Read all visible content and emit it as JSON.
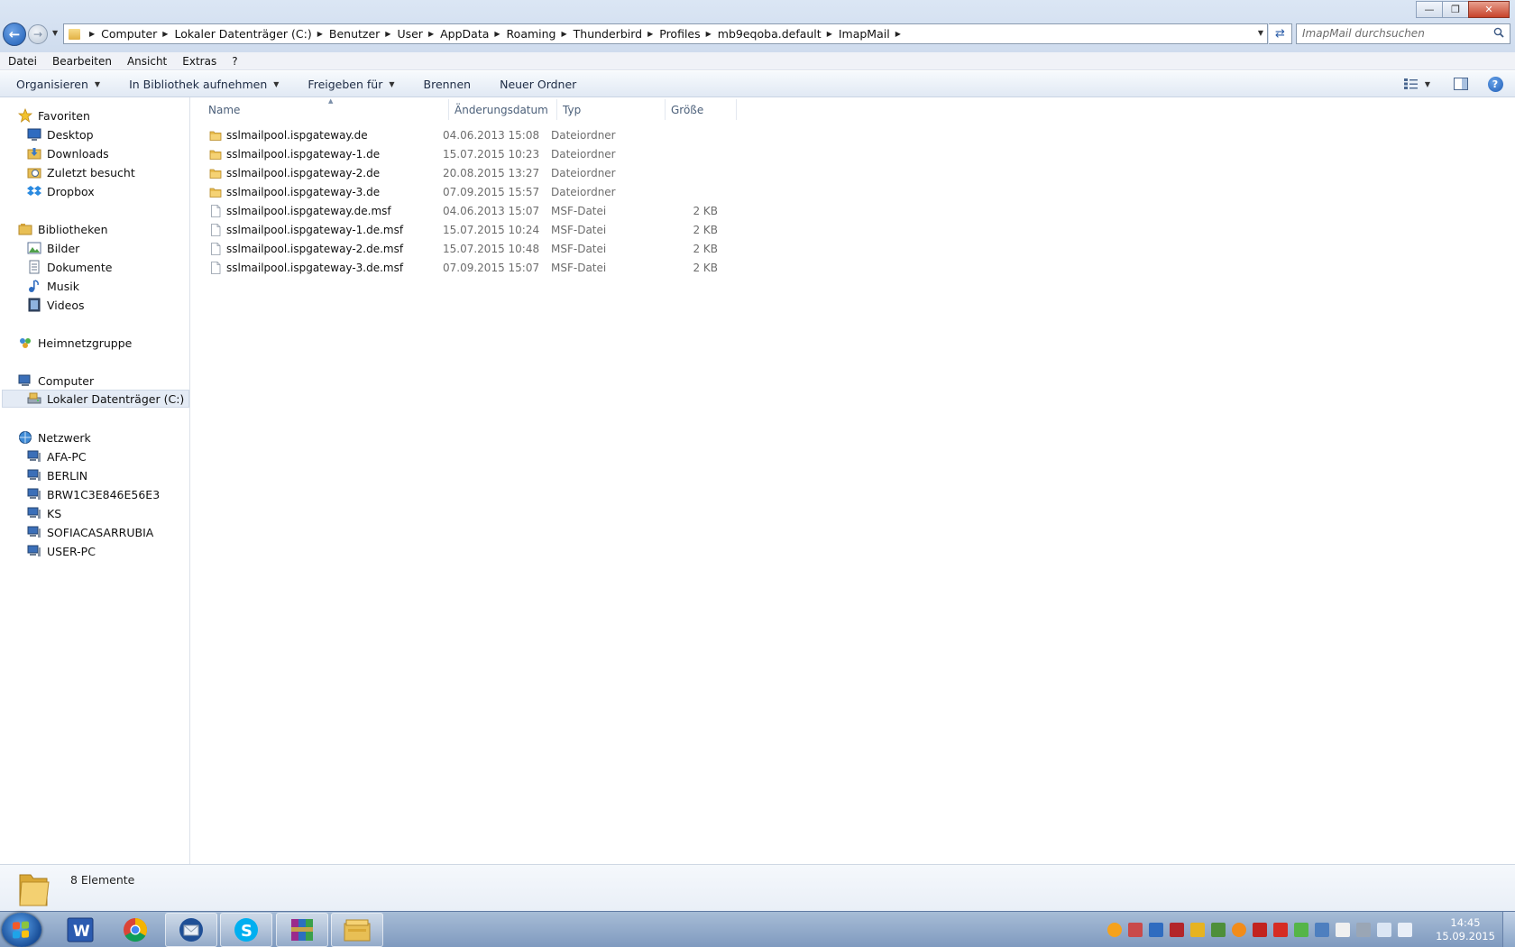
{
  "window": {
    "minimize_glyph": "—",
    "maximize_glyph": "❐",
    "close_glyph": "✕"
  },
  "address": {
    "crumbs": [
      "Computer",
      "Lokaler Datenträger (C:)",
      "Benutzer",
      "User",
      "AppData",
      "Roaming",
      "Thunderbird",
      "Profiles",
      "mb9eqoba.default",
      "ImapMail"
    ]
  },
  "search": {
    "placeholder": "ImapMail durchsuchen"
  },
  "menu": {
    "items": [
      "Datei",
      "Bearbeiten",
      "Ansicht",
      "Extras",
      "?"
    ]
  },
  "toolbar": {
    "organize": "Organisieren",
    "library": "In Bibliothek aufnehmen",
    "share": "Freigeben für",
    "burn": "Brennen",
    "new_folder": "Neuer Ordner"
  },
  "nav": {
    "favorites": "Favoriten",
    "desktop": "Desktop",
    "downloads": "Downloads",
    "recent": "Zuletzt besucht",
    "dropbox": "Dropbox",
    "libraries": "Bibliotheken",
    "pictures": "Bilder",
    "documents": "Dokumente",
    "music": "Musik",
    "videos": "Videos",
    "homegroup": "Heimnetzgruppe",
    "computer": "Computer",
    "local_disk": "Lokaler Datenträger (C:)",
    "network": "Netzwerk",
    "network_pcs": [
      "AFA-PC",
      "BERLIN",
      "BRW1C3E846E56E3",
      "KS",
      "SOFIACASARRUBIA",
      "USER-PC"
    ]
  },
  "columns": {
    "name": "Name",
    "date": "Änderungsdatum",
    "type": "Typ",
    "size": "Größe"
  },
  "files": [
    {
      "name": "sslmailpool.ispgateway.de",
      "date": "04.06.2013 15:08",
      "type": "Dateiordner",
      "size": "",
      "kind": "folder"
    },
    {
      "name": "sslmailpool.ispgateway-1.de",
      "date": "15.07.2015 10:23",
      "type": "Dateiordner",
      "size": "",
      "kind": "folder"
    },
    {
      "name": "sslmailpool.ispgateway-2.de",
      "date": "20.08.2015 13:27",
      "type": "Dateiordner",
      "size": "",
      "kind": "folder"
    },
    {
      "name": "sslmailpool.ispgateway-3.de",
      "date": "07.09.2015 15:57",
      "type": "Dateiordner",
      "size": "",
      "kind": "folder"
    },
    {
      "name": "sslmailpool.ispgateway.de.msf",
      "date": "04.06.2013 15:07",
      "type": "MSF-Datei",
      "size": "2 KB",
      "kind": "file"
    },
    {
      "name": "sslmailpool.ispgateway-1.de.msf",
      "date": "15.07.2015 10:24",
      "type": "MSF-Datei",
      "size": "2 KB",
      "kind": "file"
    },
    {
      "name": "sslmailpool.ispgateway-2.de.msf",
      "date": "15.07.2015 10:48",
      "type": "MSF-Datei",
      "size": "2 KB",
      "kind": "file"
    },
    {
      "name": "sslmailpool.ispgateway-3.de.msf",
      "date": "07.09.2015 15:07",
      "type": "MSF-Datei",
      "size": "2 KB",
      "kind": "file"
    }
  ],
  "details": {
    "count": "8 Elemente"
  },
  "taskbar": {
    "time": "14:45",
    "date": "15.09.2015",
    "apps": [
      "word-icon",
      "chrome-icon",
      "thunderbird-icon",
      "skype-icon",
      "winrar-icon",
      "explorer-icon"
    ]
  },
  "colors": {
    "accent": "#1c5cb4",
    "folder": "#e9bd4f",
    "selection": "#e4ebf5"
  }
}
